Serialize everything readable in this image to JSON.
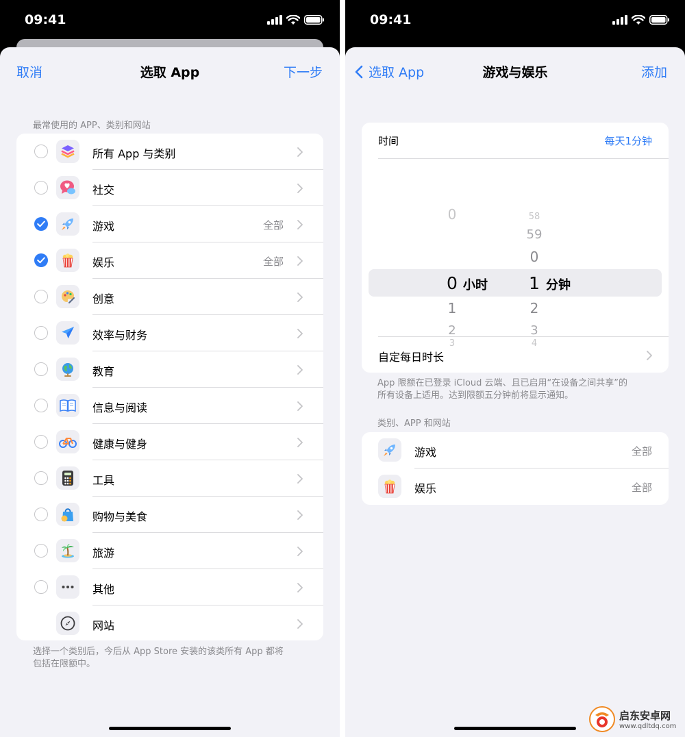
{
  "status_bar": {
    "time": "09:41"
  },
  "left": {
    "nav": {
      "cancel": "取消",
      "title": "选取 App",
      "next": "下一步"
    },
    "section_label": "最常使用的 APP、类别和网站",
    "items": [
      {
        "label": "所有 App 与类别",
        "detail": "",
        "checked": false,
        "icon": "layers-icon"
      },
      {
        "label": "社交",
        "detail": "",
        "checked": false,
        "icon": "chat-bubble-icon"
      },
      {
        "label": "游戏",
        "detail": "全部",
        "checked": true,
        "icon": "rocket-icon"
      },
      {
        "label": "娱乐",
        "detail": "全部",
        "checked": true,
        "icon": "popcorn-icon"
      },
      {
        "label": "创意",
        "detail": "",
        "checked": false,
        "icon": "palette-icon"
      },
      {
        "label": "效率与财务",
        "detail": "",
        "checked": false,
        "icon": "paper-plane-icon"
      },
      {
        "label": "教育",
        "detail": "",
        "checked": false,
        "icon": "globe-icon"
      },
      {
        "label": "信息与阅读",
        "detail": "",
        "checked": false,
        "icon": "book-icon"
      },
      {
        "label": "健康与健身",
        "detail": "",
        "checked": false,
        "icon": "bicycle-icon"
      },
      {
        "label": "工具",
        "detail": "",
        "checked": false,
        "icon": "calculator-icon"
      },
      {
        "label": "购物与美食",
        "detail": "",
        "checked": false,
        "icon": "shopping-bag-icon"
      },
      {
        "label": "旅游",
        "detail": "",
        "checked": false,
        "icon": "palm-tree-icon"
      },
      {
        "label": "其他",
        "detail": "",
        "checked": false,
        "icon": "ellipsis-icon"
      },
      {
        "label": "网站",
        "detail": "",
        "checked": false,
        "icon": "compass-icon"
      }
    ],
    "footer_line1": "选择一个类别后，今后从 App Store 安装的该类所有 App 都将",
    "footer_line2": "包括在限额中。"
  },
  "right": {
    "nav": {
      "back": "选取 App",
      "title": "游戏与娱乐",
      "add": "添加"
    },
    "time_label": "时间",
    "time_value": "每天1分钟",
    "picker": {
      "hours_above": [
        "0"
      ],
      "hours_selected": "0",
      "hours_unit": "小时",
      "hours_below": [
        "1",
        "2",
        "3"
      ],
      "minutes_above": [
        "58",
        "59",
        "0"
      ],
      "minutes_selected": "1",
      "minutes_unit": "分钟",
      "minutes_below": [
        "2",
        "3",
        "4"
      ]
    },
    "custom_label": "自定每日时长",
    "note_line1": "App 限额在已登录 iCloud 云端、且已启用“在设备之间共享”的",
    "note_line2": "所有设备上适用。达到限额五分钟前将显示通知。",
    "section_label": "类别、APP 和网站",
    "items": [
      {
        "label": "游戏",
        "detail": "全部",
        "icon": "rocket-icon"
      },
      {
        "label": "娱乐",
        "detail": "全部",
        "icon": "popcorn-icon"
      }
    ]
  },
  "watermark": {
    "name": "启东安卓网",
    "url": "www.qdltdq.com"
  },
  "colors": {
    "accent": "#2f7cf6",
    "background": "#f2f2f7",
    "secondary_text": "#8a8a8e"
  }
}
